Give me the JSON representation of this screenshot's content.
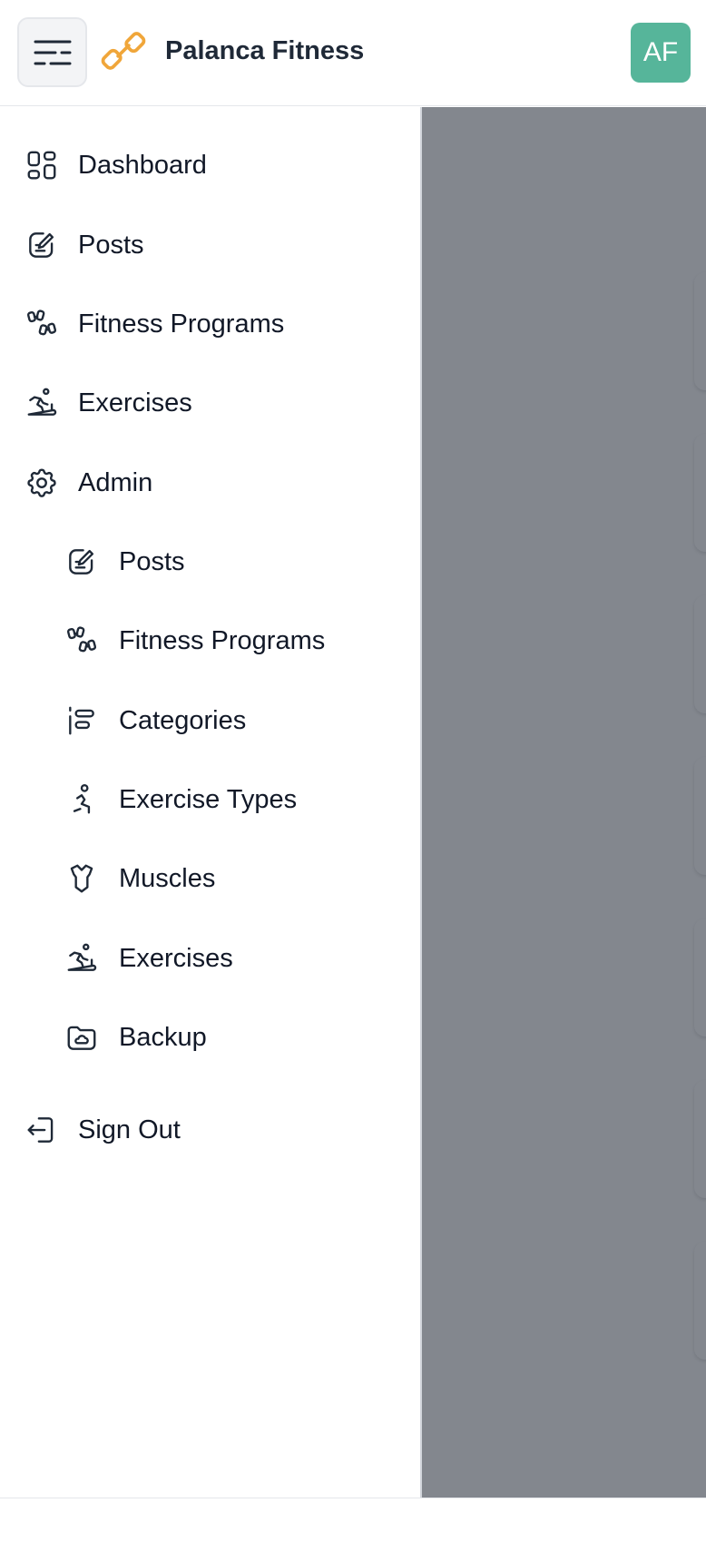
{
  "app": {
    "title": "Palanca Fitness",
    "avatar_initials": "AF",
    "accent_color": "#f0a63a",
    "avatar_color": "#56b59a",
    "menu_icon": "menu-icon",
    "logo_icon": "dumbbell-logo-icon"
  },
  "drawer": {
    "top_items": [
      {
        "label": "Dashboard",
        "icon": "dashboard-icon"
      },
      {
        "label": "Posts",
        "icon": "edit-note-icon"
      },
      {
        "label": "Fitness Programs",
        "icon": "dumbbells-icon"
      },
      {
        "label": "Exercises",
        "icon": "treadmill-icon"
      },
      {
        "label": "Admin",
        "icon": "gear-icon"
      }
    ],
    "admin_items": [
      {
        "label": "Posts",
        "icon": "edit-note-icon"
      },
      {
        "label": "Fitness Programs",
        "icon": "dumbbells-icon"
      },
      {
        "label": "Categories",
        "icon": "align-left-icon"
      },
      {
        "label": "Exercise Types",
        "icon": "stretching-icon"
      },
      {
        "label": "Muscles",
        "icon": "shirt-icon"
      },
      {
        "label": "Exercises",
        "icon": "treadmill-icon"
      },
      {
        "label": "Backup",
        "icon": "folder-cloud-icon"
      }
    ],
    "sign_out": {
      "label": "Sign Out",
      "icon": "logout-icon"
    }
  },
  "background_cards": [
    {
      "icon": "edit-note-icon"
    },
    {
      "icon": "dumbbells-icon"
    },
    {
      "icon": "align-left-icon"
    },
    {
      "icon": "stretching-icon"
    },
    {
      "icon": "shirt-icon"
    },
    {
      "icon": "treadmill-icon"
    },
    {
      "icon": "folder-cloud-icon"
    }
  ]
}
